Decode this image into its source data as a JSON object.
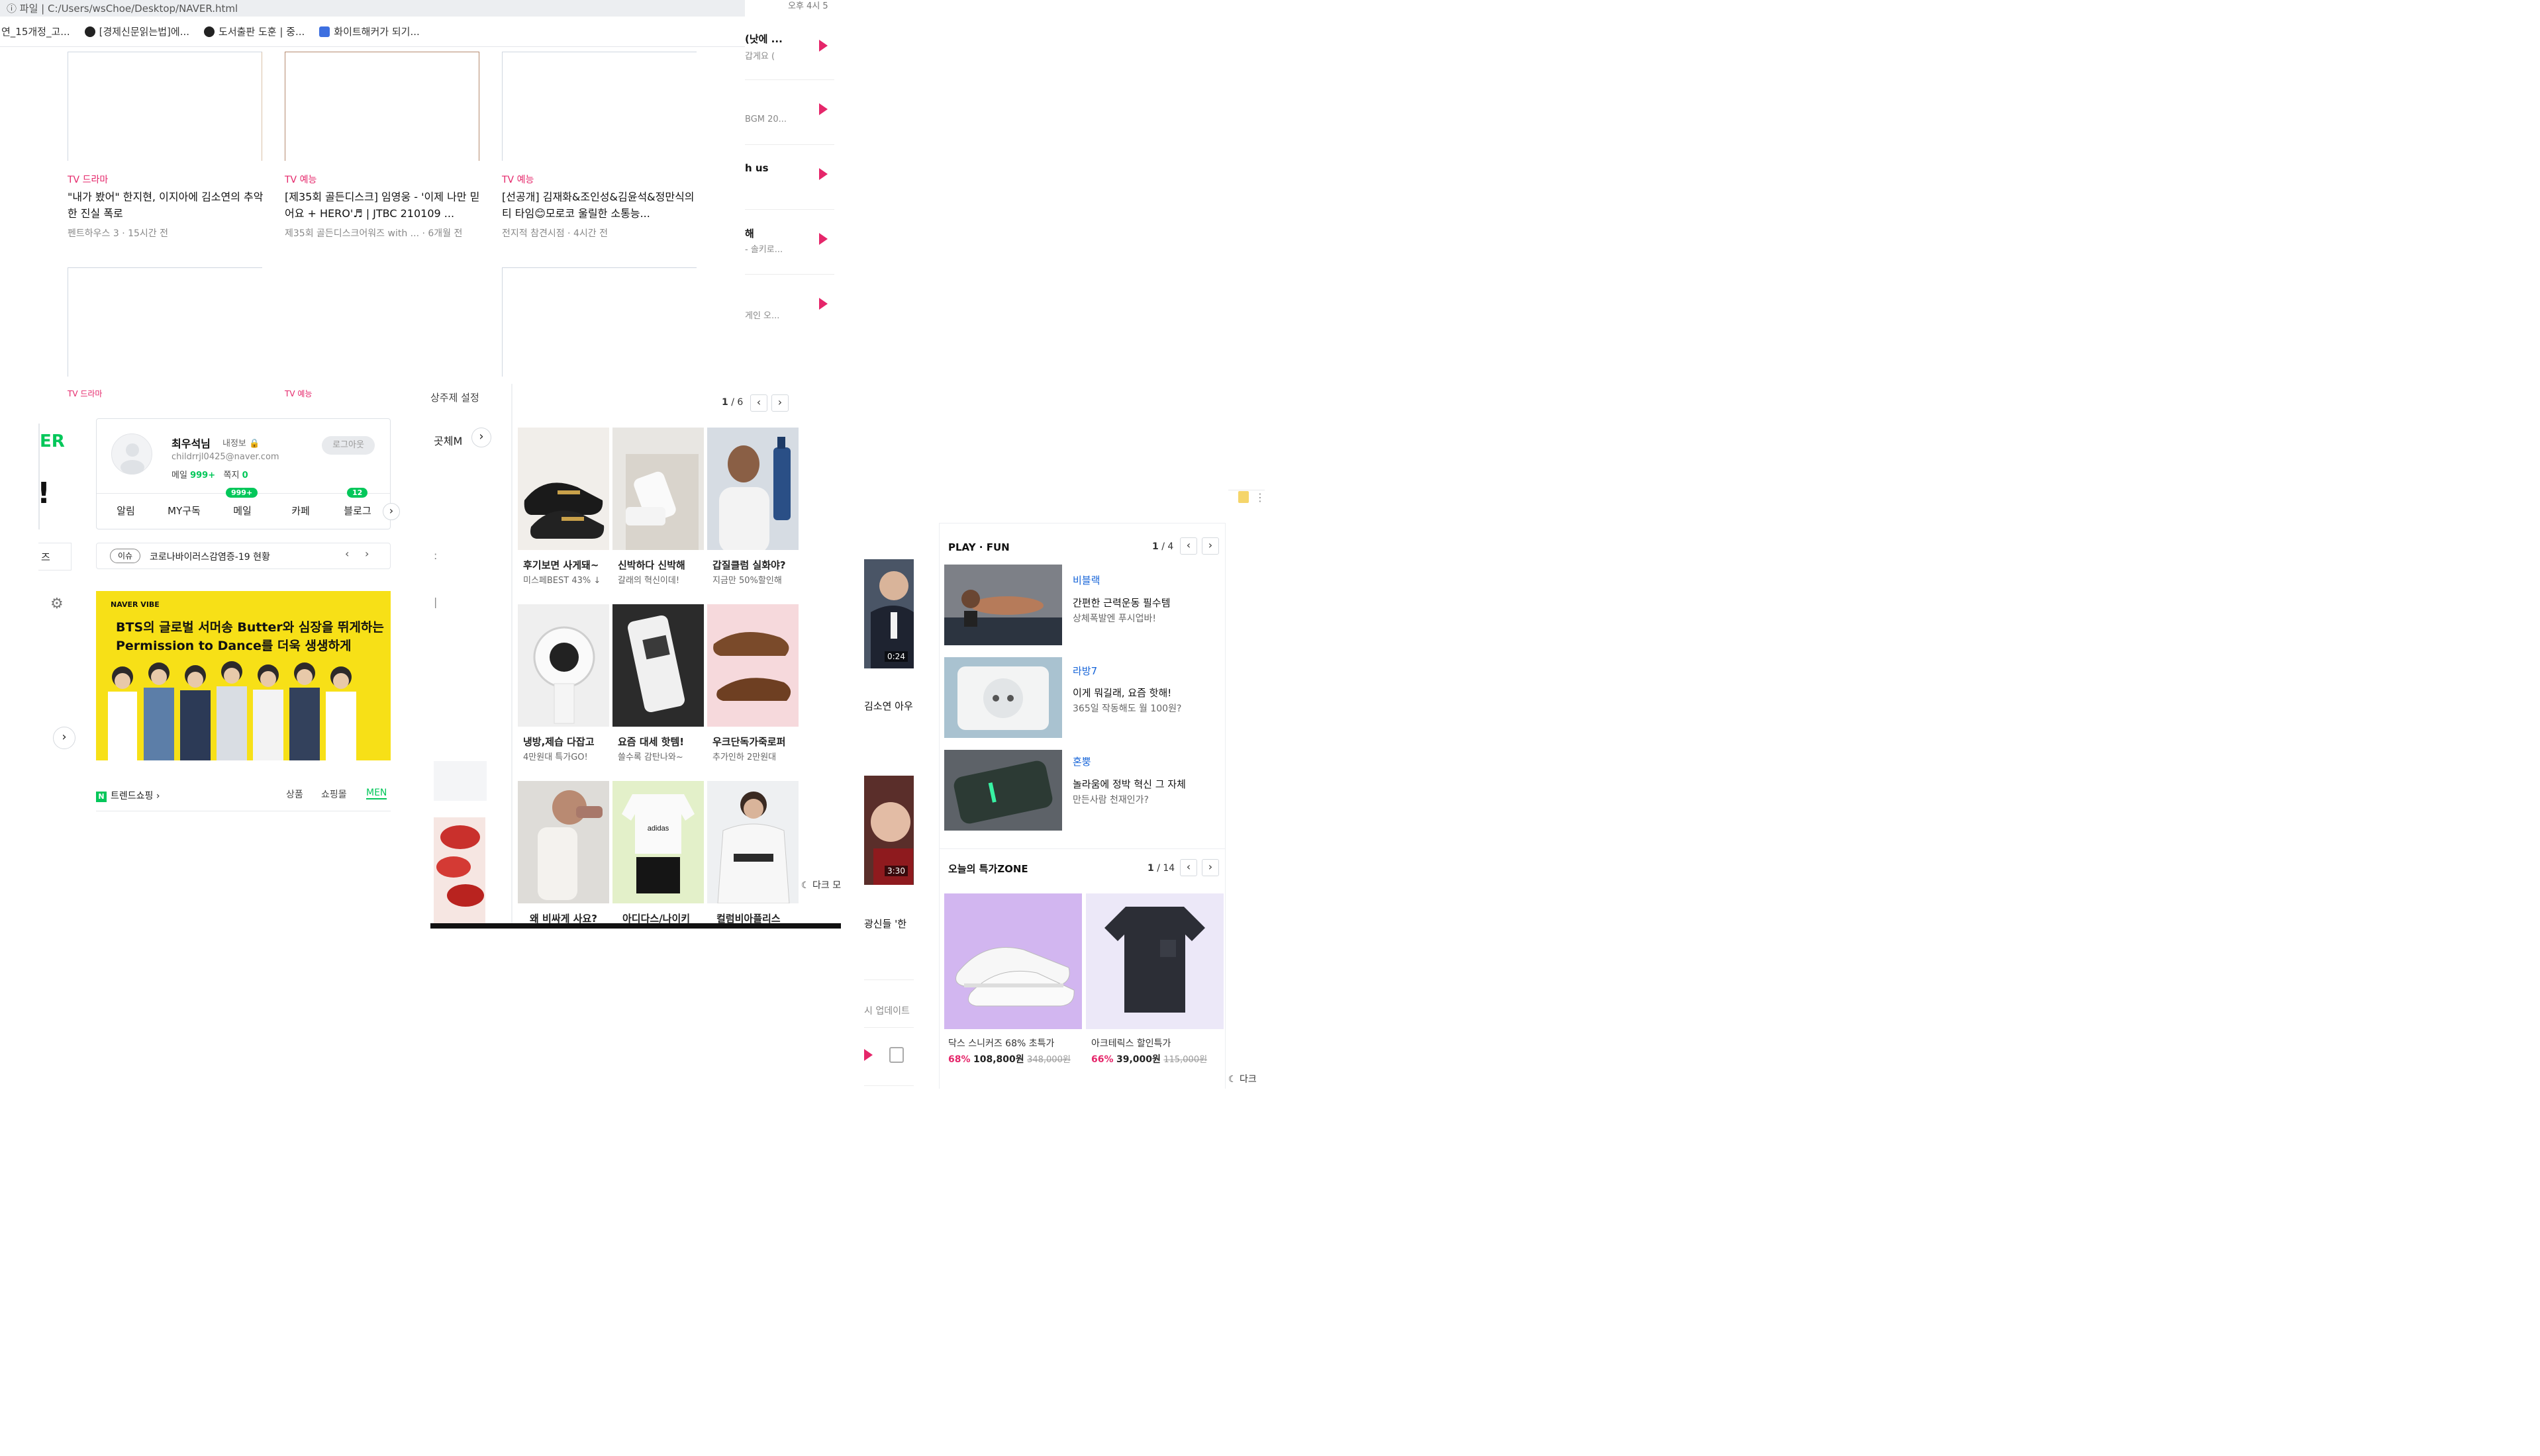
{
  "browser": {
    "address_prefix": "파일",
    "address": "C:/Users/wsChoe/Desktop/NAVER.html",
    "bookmarks": [
      "연_15개정_고...",
      "[경제신문읽는법]에...",
      "도서출판 도훈 | 중...",
      "화이트해커가 되기..."
    ]
  },
  "videos": [
    {
      "cat": "TV 드라마",
      "title": "\"내가 봤어\" 한지현, 이지아에 김소연의 추악한 진실 폭로",
      "meta": "펜트하우스 3 · 15시간 전"
    },
    {
      "cat": "TV 예능",
      "title": "[제35회 골든디스크] 임영웅 - '이제 나만 믿어요 + HERO'♬ | JTBC 210109 ...",
      "meta": "제35회 골든디스크어워즈 with ... · 6개월 전"
    },
    {
      "cat": "TV 예능",
      "title": "[선공개] 김재화&조인성&김윤석&정만식의 티 타임😊모로코 울릴한 소통능...",
      "meta": "전지적 참견시점 · 4시간 전"
    },
    {
      "cat": "TV 드라마"
    },
    {
      "cat": "TV 예능"
    }
  ],
  "right_strip": {
    "top_text": "오후 4시 5",
    "items": [
      {
        "title": "(낫에 ...",
        "sub": "갑게요 ("
      },
      {
        "title": "",
        "sub": "BGM 20..."
      },
      {
        "title": "h us",
        "sub": ""
      },
      {
        "title": "해",
        "sub": "- 솔키로..."
      },
      {
        "title": "",
        "sub": "게인 오..."
      }
    ]
  },
  "left_edge": {
    "brand_fragment": "ER",
    "bang": "!",
    "tab_fragment": "즈"
  },
  "theme_setting_label": "상주제 설정",
  "login": {
    "name": "최우석님",
    "tag": "내정보",
    "lock": "🔒",
    "email": "childrrjl0425@naver.com",
    "mail_label": "메일",
    "mail_count": "999+",
    "note_label": "쪽지",
    "note_count": "0",
    "logout": "로그아웃",
    "tabs": [
      "알림",
      "MY구독",
      "메일",
      "카페",
      "블로그"
    ],
    "mail_badge": "999+",
    "blog_badge": "12"
  },
  "issue": {
    "tag": "이슈",
    "text": "코로나바이러스감염증-19 현황"
  },
  "banner": {
    "brand": "NAVER VIBE",
    "line1": "BTS의 글로벌 서머송 Butter와 심장을 뛰게하는",
    "line2": "Permission to Dance를 더욱 생생하게"
  },
  "trend": {
    "label": "트렌드쇼핑",
    "tabs": [
      "상품",
      "쇼핑몰",
      "MEN"
    ]
  },
  "shopping": {
    "page": "1",
    "total": "6",
    "side_label": "곳체M",
    "items": [
      {
        "t": "후기보면 사게돼~",
        "s": "미스페BEST 43% ↓"
      },
      {
        "t": "신박하다 신박해",
        "s": "갈래의 혁신이데!"
      },
      {
        "t": "갑질클럼 실화야?",
        "s": "지금만 50%할인해"
      },
      {
        "t": "냉방,제습 다잡고",
        "s": "4만원대 특가GO!"
      },
      {
        "t": "요즘 대세 핫템!",
        "s": "쓸수록 감탄나와~"
      },
      {
        "t": "우크단독가죽로퍼",
        "s": "추가인하 2만원대"
      },
      {
        "t": "왜 비싸게 사요?",
        "s": ""
      },
      {
        "t": "아디다스/나이키",
        "s": ""
      },
      {
        "t": "컬럼비아플리스",
        "s": ""
      }
    ],
    "dark_mode": "다크 모"
  },
  "play_fun": {
    "title": "PLAY · FUN",
    "page": "1",
    "total": "4",
    "items": [
      {
        "src": "비블랙",
        "t": "간편한 근력운동 필수템",
        "s": "상체폭발엔 푸시업바!"
      },
      {
        "src": "라방7",
        "t": "이게 뭐길래, 요즘 핫해!",
        "s": "365일 작동해도 월 100원?"
      },
      {
        "src": "혼뿡",
        "t": "놀라움에 정박 혁신 그 자체",
        "s": "만든사람 천재인가?"
      }
    ]
  },
  "mid_strip": {
    "dur1": "0:24",
    "caption1": "김소연 아우",
    "dur2": "3:30",
    "caption2": "광신들 '한",
    "update": "시 업데이트"
  },
  "deal_zone": {
    "title": "오늘의 특가ZONE",
    "page": "1",
    "total": "14",
    "items": [
      {
        "name": "닥스 스니커즈 68% 초특가",
        "pct": "68%",
        "price": "108,800원",
        "old": "348,000원"
      },
      {
        "name": "아크테릭스 할인특가",
        "pct": "66%",
        "price": "39,000원",
        "old": "115,000원"
      }
    ],
    "dark_mode": "다크"
  },
  "colors": {
    "accent": "#e5266a",
    "naver_green": "#03c75a",
    "link_blue": "#1463d8",
    "banner_yellow": "#f7e017"
  }
}
